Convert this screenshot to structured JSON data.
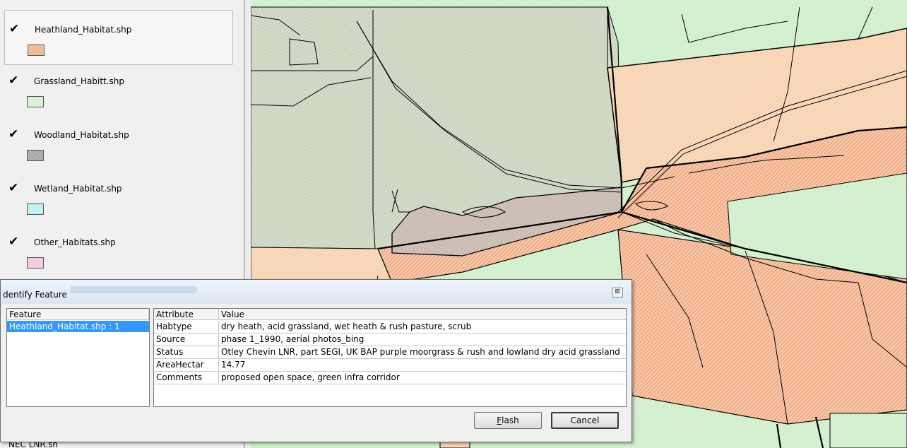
{
  "legend": {
    "layers": [
      {
        "name": "Heathland_Habitat.shp",
        "checked": "✔",
        "swatch": "#f6c79e"
      },
      {
        "name": "Grassland_Habitt.shp",
        "checked": "✔",
        "swatch": "#d8f3d4"
      },
      {
        "name": "Woodland_Habitat.shp",
        "checked": "✔",
        "swatch": "#bdbdbd"
      },
      {
        "name": "Wetland_Habitat.shp",
        "checked": "✔",
        "swatch": "#bff2f2"
      },
      {
        "name": "Other_Habitats.shp",
        "checked": "✔",
        "swatch": "#f3cce0"
      }
    ],
    "partial_item": "NEC LNR.sh"
  },
  "map": {
    "colors": {
      "heath": "#f4c8a8",
      "heath_hatch": "#ee7f5a",
      "grass": "#d6f2d2",
      "grass_hatch": "#9ad294",
      "wood": "#d2ddc8",
      "wood_hatch": "#8c9a7c",
      "outline": "#000000"
    }
  },
  "dialog": {
    "title": "dentify Feature",
    "close_glyph": "⊠",
    "feature_header": "Feature",
    "selected_feature": "Heathland_Habitat.shp : 1",
    "attr_header": "Attribute",
    "value_header": "Value",
    "rows": [
      {
        "attribute": "Habtype",
        "value": "dry heath, acid grassland, wet heath & rush pasture, scrub"
      },
      {
        "attribute": "Source",
        "value": "phase 1_1990, aerial photos_bing"
      },
      {
        "attribute": "Status",
        "value": "Otley Chevin LNR, part SEGI, UK BAP purple moorgrass & rush and lowland dry acid grassland"
      },
      {
        "attribute": "AreaHectar",
        "value": "14.77"
      },
      {
        "attribute": "Comments",
        "value": "proposed open space, green infra corridor"
      }
    ],
    "flash_label_hot": "F",
    "flash_label_rest": "lash",
    "cancel_label": "Cancel"
  }
}
